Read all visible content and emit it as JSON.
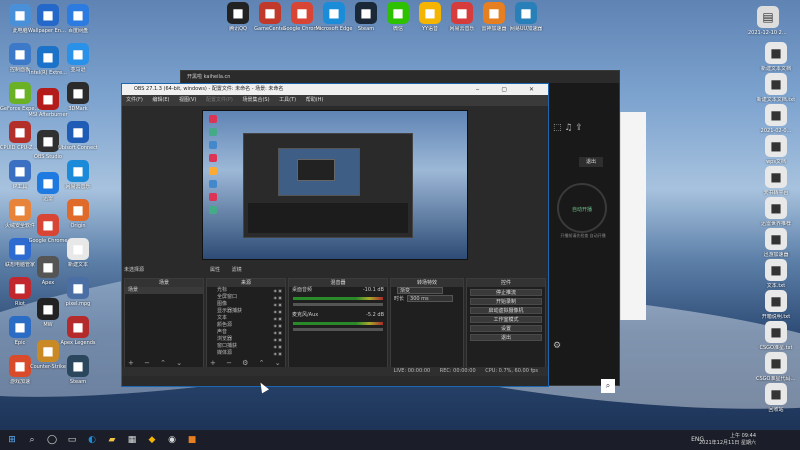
{
  "desktop_icons_left": [
    {
      "label": "此电脑",
      "icon": "computer-icon",
      "color": "#4a90d9"
    },
    {
      "label": "控制面板",
      "icon": "control-panel-icon",
      "color": "#3c79c8"
    },
    {
      "label": "GeForce Experience",
      "icon": "nvidia-icon",
      "color": "#6bb125"
    },
    {
      "label": "CPUID CPU-Z MSI",
      "icon": "cpuz-icon",
      "color": "#b3302a"
    },
    {
      "label": "IP工具",
      "icon": "tool-icon",
      "color": "#3a6fc2"
    },
    {
      "label": "火绒安全软件",
      "icon": "shield-icon",
      "color": "#e8833a"
    },
    {
      "label": "联想电脑管家",
      "icon": "manager-icon",
      "color": "#2d6bd1"
    },
    {
      "label": "Riot",
      "icon": "game-icon",
      "color": "#c2272d"
    },
    {
      "label": "Epic",
      "icon": "epic-icon",
      "color": "#2b6cc4"
    },
    {
      "label": "游戏加速",
      "icon": "speed-icon",
      "color": "#d94b2a"
    }
  ],
  "desktop_icons_col2": [
    {
      "label": "Wallpaper Engine",
      "icon": "wallpaper-icon",
      "color": "#2468c9"
    },
    {
      "label": "Intel(R) Extre...",
      "icon": "intel-icon",
      "color": "#1a73c8"
    },
    {
      "label": "MSI Afterburner",
      "icon": "afterburner-icon",
      "color": "#b41c1c"
    },
    {
      "label": "OBS Studio",
      "icon": "obs-icon",
      "color": "#303030"
    },
    {
      "label": "迅雷",
      "icon": "thunder-icon",
      "color": "#1e7ae0"
    },
    {
      "label": "Google Chrome",
      "icon": "chrome-icon",
      "color": "#d94535"
    },
    {
      "label": "Apex",
      "icon": "apex-icon",
      "color": "#555555"
    },
    {
      "label": "MW",
      "icon": "mw-icon",
      "color": "#222222"
    },
    {
      "label": "Counter-Strike",
      "icon": "cs-icon",
      "color": "#c98a25"
    }
  ],
  "desktop_icons_col3": [
    {
      "label": "百度网盘",
      "icon": "baidu-icon",
      "color": "#2b7be0"
    },
    {
      "label": "亚马逊",
      "icon": "chat-icon",
      "color": "#2a91e8"
    },
    {
      "label": "3DMark",
      "icon": "3dmark-icon",
      "color": "#2b2b2b"
    },
    {
      "label": "Ubisoft Connect",
      "icon": "ubisoft-icon",
      "color": "#1f5cb5"
    },
    {
      "label": "网易云音乐",
      "icon": "music-icon",
      "color": "#1b8ad9"
    },
    {
      "label": "Origin",
      "icon": "origin-icon",
      "color": "#e06a2a"
    },
    {
      "label": "新建文本",
      "icon": "file-icon",
      "color": "#e8e8e8"
    },
    {
      "label": "pixel.mpg",
      "icon": "video-icon",
      "color": "#4b6fa5"
    },
    {
      "label": "Apex Legends",
      "icon": "apex-legends-icon",
      "color": "#b52a2a"
    },
    {
      "label": "Steam",
      "icon": "steam-icon",
      "color": "#2a475e"
    }
  ],
  "desktop_icons_top": [
    {
      "label": "腾讯QQ",
      "icon": "qq-icon",
      "color": "#222222"
    },
    {
      "label": "GameCenter",
      "icon": "gamecenter-icon",
      "color": "#c0392b"
    },
    {
      "label": "Google Chrome",
      "icon": "chrome-icon",
      "color": "#d94535"
    },
    {
      "label": "Microsoft Edge",
      "icon": "edge-icon",
      "color": "#1b8cd8"
    },
    {
      "label": "Steam",
      "icon": "steam-icon",
      "color": "#1b2838"
    },
    {
      "label": "微信",
      "icon": "wechat-icon",
      "color": "#2dc100"
    },
    {
      "label": "YY语音",
      "icon": "yy-icon",
      "color": "#f4b400"
    },
    {
      "label": "网易云音乐",
      "icon": "netease-icon",
      "color": "#d63c3c"
    },
    {
      "label": "雷神加速器",
      "icon": "accelerator-icon",
      "color": "#e67e22"
    },
    {
      "label": "网易UU加速器",
      "icon": "uu-icon",
      "color": "#2980b9"
    }
  ],
  "desktop_icons_right": [
    {
      "label": "新建文本文档",
      "icon": "file-icon"
    },
    {
      "label": "新建文本文档.txt",
      "icon": "file-icon"
    },
    {
      "label": "2021-02-0...",
      "icon": "file-icon"
    },
    {
      "label": "wps文档",
      "icon": "file-icon"
    },
    {
      "label": "天书转平台",
      "icon": "screen-icon"
    },
    {
      "label": "迅雷世界推荐",
      "icon": "app-icon"
    },
    {
      "label": "迅游加速器",
      "icon": "app-icon"
    },
    {
      "label": "文本.txt",
      "icon": "file-icon"
    },
    {
      "label": "开箱说明.txt",
      "icon": "file-icon"
    },
    {
      "label": "CSGO准星.txt",
      "icon": "file-icon"
    },
    {
      "label": "CSGO准星代码.txt",
      "icon": "file-icon"
    },
    {
      "label": "回收站",
      "icon": "recycle-bin-icon"
    }
  ],
  "top_right_datetime": "2021-12-10 21-52-17_...",
  "background_window": {
    "title": "开黑啦 kaiheila.cn",
    "exit_label": "退出",
    "record_label": "自动开播",
    "hint": "开播前请先检查 自动开播"
  },
  "obs": {
    "title": "OBS 27.1.3 (64-bit, windows) - 配置文件: 未命名 - 场景: 未命名",
    "menu": [
      "文件(F)",
      "编辑(E)",
      "视图(V)",
      "配置文件(P)",
      "场景集合(S)",
      "工具(T)",
      "帮助(H)"
    ],
    "scene_label": "未选择源",
    "tabs": [
      "属性",
      "滤镜"
    ],
    "docks": {
      "scenes": {
        "title": "场景",
        "items": [
          "场景"
        ]
      },
      "sources": {
        "title": "来源",
        "items": [
          "光标",
          "全屏窗口",
          "图像",
          "显示器捕获",
          "文本",
          "颜色源",
          "声音",
          "浏览器",
          "窗口捕获",
          "媒体源"
        ]
      },
      "mixer": {
        "title": "混音器",
        "tracks": [
          {
            "name": "桌面音频",
            "db": "-10.1 dB"
          },
          {
            "name": "麦克风/Aux",
            "db": "-5.2 dB"
          }
        ]
      },
      "transitions": {
        "title": "转场特效",
        "fade": "渐变",
        "duration_label": "时长",
        "duration_value": "300 ms"
      },
      "controls": {
        "title": "控件",
        "buttons": [
          "停止推流",
          "开始录制",
          "启动虚拟摄像机",
          "工作室模式",
          "设置",
          "退出"
        ]
      }
    },
    "status": {
      "live": "LIVE: 00:00:00",
      "rec": "REC: 00:00:00",
      "cpu": "CPU: 0.7%, 60.00 fps"
    }
  },
  "taskbar": {
    "time": "上午 09:44",
    "date": "2021年12月11日 星期六",
    "lang": "ENG"
  }
}
